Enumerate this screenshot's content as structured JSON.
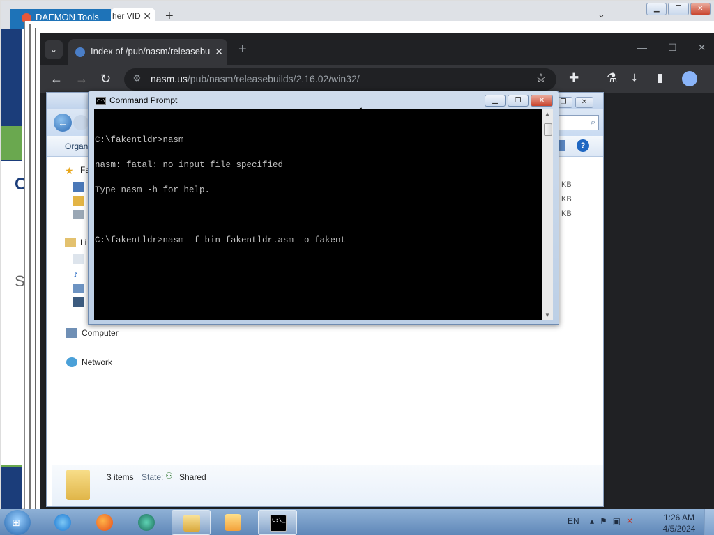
{
  "back_browser": {
    "tab_daemon": "DAEMON Tools",
    "tab_other": "her VID",
    "tab_close": "✕",
    "new_tab": "+",
    "overflow": "⌄"
  },
  "chrome": {
    "tab_title": "Index of /pub/nasm/releasebu",
    "tab_close": "✕",
    "new_tab": "+",
    "url_host": "nasm.us",
    "url_path": "/pub/nasm/releasebuilds/2.16.02/win32/"
  },
  "explorer": {
    "organize": "Organ",
    "nav": {
      "favorites": "Fa",
      "libraries": "Li",
      "computer": "Computer",
      "network": "Network"
    },
    "sizes": [
      "KB",
      "KB",
      "KB"
    ],
    "details": {
      "count": "3 items",
      "state_label": "State:",
      "state_value": "Shared"
    }
  },
  "cmd": {
    "title": "Command Prompt",
    "icon_text": "C:\\",
    "lines": [
      "C:\\fakentldr>nasm",
      "nasm: fatal: no input file specified",
      "Type nasm -h for help.",
      "",
      "C:\\fakentldr>nasm -f bin fakentldr.asm -o fakent"
    ]
  },
  "taskbar": {
    "items": [
      "start",
      "internet-explorer",
      "firefox",
      "vpn-app",
      "file-explorer",
      "media-player",
      "command-prompt"
    ],
    "active_item": "command-prompt",
    "language": "EN",
    "time": "1:26 AM",
    "date": "4/5/2024"
  }
}
